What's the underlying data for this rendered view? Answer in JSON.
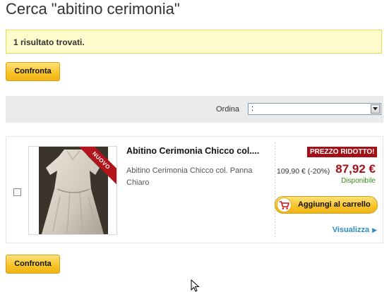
{
  "page": {
    "title": "Cerca \"abitino cerimonia\""
  },
  "results": {
    "summary": "1 risultato trovati."
  },
  "actions": {
    "compare_label": "Confronta"
  },
  "sort": {
    "label": "Ordina",
    "selected": ":"
  },
  "product": {
    "title": "Abitino Cerimonia Chicco col....",
    "description": "Abitino Cerimonia Chicco col. Panna Chiaro",
    "badge_new": "NUOVO",
    "sale_badge": "PREZZO RIDOTTO!",
    "old_price": "109,90 € (-20%)",
    "price": "87,92 €",
    "availability": "Disponibile",
    "add_to_cart": "Aggiungi al carrello",
    "view_link": "Visualizza"
  },
  "colors": {
    "accent_yellow": "#f7c325",
    "price_red": "#a31118",
    "link_blue": "#2a8fc7",
    "available_green": "#3a8a1a"
  },
  "icons": [
    "cart-icon",
    "chevron-down-icon",
    "chevron-right-icon",
    "mouse-cursor-icon"
  ]
}
